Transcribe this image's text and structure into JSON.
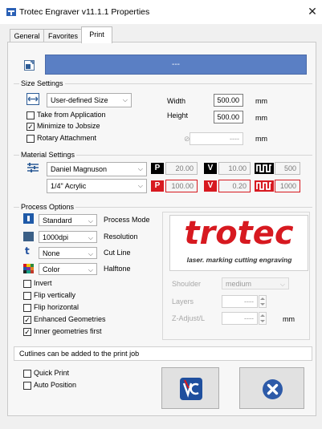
{
  "window": {
    "title": "Trotec Engraver v11.1.1 Properties"
  },
  "tabs": [
    {
      "label": "General"
    },
    {
      "label": "Favorites"
    },
    {
      "label": "Print"
    }
  ],
  "jobname": {
    "value": "---"
  },
  "size_settings": {
    "title": "Size Settings",
    "size_mode": "User-defined Size",
    "take_from_application": "Take from Application",
    "minimize_to_jobsize": "Minimize to Jobsize",
    "rotary_attachment": "Rotary Attachment",
    "width_label": "Width",
    "width_value": "500.00",
    "width_unit": "mm",
    "height_label": "Height",
    "height_value": "500.00",
    "height_unit": "mm",
    "rotary_value": "----",
    "rotary_unit": "mm",
    "diameter_symbol": "⊘"
  },
  "material_settings": {
    "title": "Material Settings",
    "material_group": "Daniel Magnuson",
    "material": "1/4\" Acrylic",
    "row1": {
      "p": "20.00",
      "v": "10.00",
      "freq": "500"
    },
    "row2": {
      "p": "100.00",
      "v": "0.20",
      "freq": "1000"
    },
    "badges": {
      "p": "P",
      "v": "V"
    }
  },
  "process_options": {
    "title": "Process Options",
    "process_mode_value": "Standard",
    "process_mode_label": "Process Mode",
    "resolution_value": "1000dpi",
    "resolution_label": "Resolution",
    "cutline_value": "None",
    "cutline_label": "Cut Line",
    "halftone_value": "Color",
    "halftone_label": "Halftone",
    "invert": "Invert",
    "flip_vertically": "Flip vertically",
    "flip_horizontal": "Flip horizontal",
    "enhanced_geometries": "Enhanced Geometries",
    "inner_geometries_first": "Inner geometries first",
    "cutline_icon_letter": "t"
  },
  "logo": {
    "brand": "trotec",
    "tagline": "laser. marking cutting engraving"
  },
  "advanced": {
    "shoulder_label": "Shoulder",
    "shoulder_value": "medium",
    "layers_label": "Layers",
    "layers_value": "----",
    "zadjust_label": "Z-Adjust/L",
    "zadjust_value": "----",
    "zadjust_unit": "mm"
  },
  "info": {
    "message": "Cutlines can be added to the print job"
  },
  "bottom": {
    "quick_print": "Quick Print",
    "auto_position": "Auto Position"
  },
  "colors": {
    "jobname_bar": "#5a7fc4",
    "trotec_red": "#d71920",
    "cancel_blue": "#2d5aa8",
    "jobcontrol_blue": "#1f4f9e"
  }
}
